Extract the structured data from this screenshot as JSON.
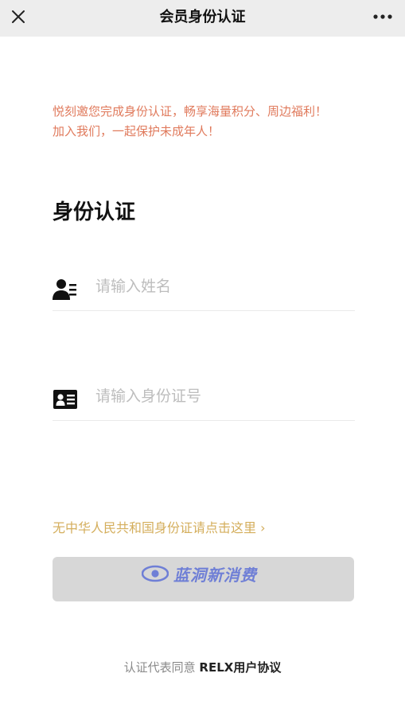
{
  "header": {
    "title": "会员身份认证",
    "close_icon": "close-icon",
    "more_icon": "more-dots-icon"
  },
  "notice": {
    "line1": "悦刻邀您完成身份认证，畅享海量积分、周边福利！",
    "line2": "加入我们，一起保护未成年人！",
    "color": "#e07a5c"
  },
  "form": {
    "title": "身份认证",
    "name_field": {
      "icon": "user-list-icon",
      "placeholder": "请输入姓名",
      "value": ""
    },
    "id_field": {
      "icon": "id-card-icon",
      "placeholder": "请输入身份证号",
      "value": ""
    }
  },
  "alt_link": {
    "label": "无中华人民共和国身份证请点击这里 ›",
    "color": "#d4ae5c"
  },
  "submit": {
    "label": "",
    "bg": "#d7d7d7"
  },
  "watermark": {
    "text": "蓝洞新消费"
  },
  "agreement": {
    "prefix": "认证代表同意 ",
    "link": "RELX用户协议"
  }
}
